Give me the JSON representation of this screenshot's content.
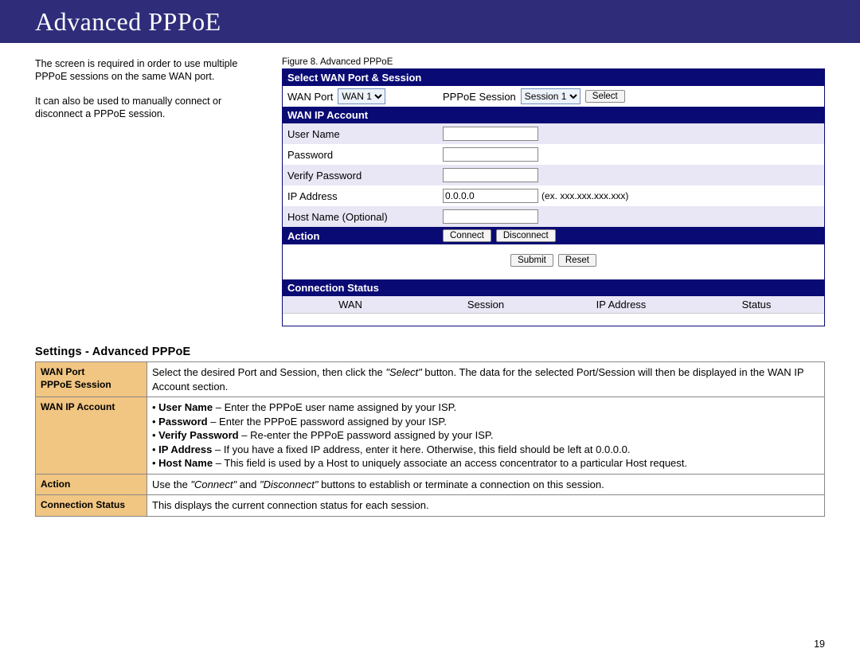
{
  "title": "Advanced PPPoE",
  "intro": {
    "p1": "The screen is required in order to use multiple PPPoE sessions on the same WAN port.",
    "p2": "It can also be used to manually connect or disconnect a PPPoE session."
  },
  "figure_caption": "Figure 8. Advanced PPPoE",
  "panel": {
    "select_header": "Select WAN Port & Session",
    "wan_port_label": "WAN Port",
    "wan_port_value": "WAN 1",
    "pppoe_session_label": "PPPoE Session",
    "pppoe_session_value": "Session 1",
    "select_button": "Select",
    "wan_ip_header": "WAN IP Account",
    "user_name_label": "User Name",
    "user_name_value": "",
    "password_label": "Password",
    "password_value": "",
    "verify_password_label": "Verify Password",
    "verify_password_value": "",
    "ip_address_label": "IP Address",
    "ip_address_value": "0.0.0.0",
    "ip_address_hint": "(ex. xxx.xxx.xxx.xxx)",
    "host_name_label": "Host Name (Optional)",
    "host_name_value": "",
    "action_header": "Action",
    "connect_button": "Connect",
    "disconnect_button": "Disconnect",
    "submit_button": "Submit",
    "reset_button": "Reset",
    "connection_status_header": "Connection Status",
    "status_cols": {
      "c1": "WAN",
      "c2": "Session",
      "c3": "IP Address",
      "c4": "Status"
    }
  },
  "settings_heading": "Settings - Advanced PPPoE",
  "settings": {
    "row1": {
      "k1": "WAN Port",
      "k2": "PPPoE Session",
      "v_pre": "Select the desired Port and Session, then click the ",
      "v_em": "\"Select\"",
      "v_post": " button. The data for the selected Port/Session will then be displayed in the WAN IP Account section."
    },
    "row2": {
      "k": "WAN IP Account",
      "b1a": "User Name",
      "b1b": " – Enter the PPPoE user name assigned by your ISP.",
      "b2a": "Password",
      "b2b": " – Enter the PPPoE password assigned by your ISP.",
      "b3a": "Verify Password",
      "b3b": " – Re-enter the PPPoE password assigned by your ISP.",
      "b4a": "IP Address",
      "b4b": " – If you have a fixed IP address, enter it here. Otherwise, this field should be left at 0.0.0.0.",
      "b5a": "Host Name",
      "b5b": " – This field is used by a Host to uniquely associate an access concentrator to a particular Host request."
    },
    "row3": {
      "k": "Action",
      "v1": "Use the ",
      "v_em1": "\"Connect\"",
      "v2": " and ",
      "v_em2": "\"Disconnect\"",
      "v3": " buttons to establish or terminate a connection on this session."
    },
    "row4": {
      "k": "Connection Status",
      "v": "This displays the current connection status for each session."
    }
  },
  "page_number": "19"
}
